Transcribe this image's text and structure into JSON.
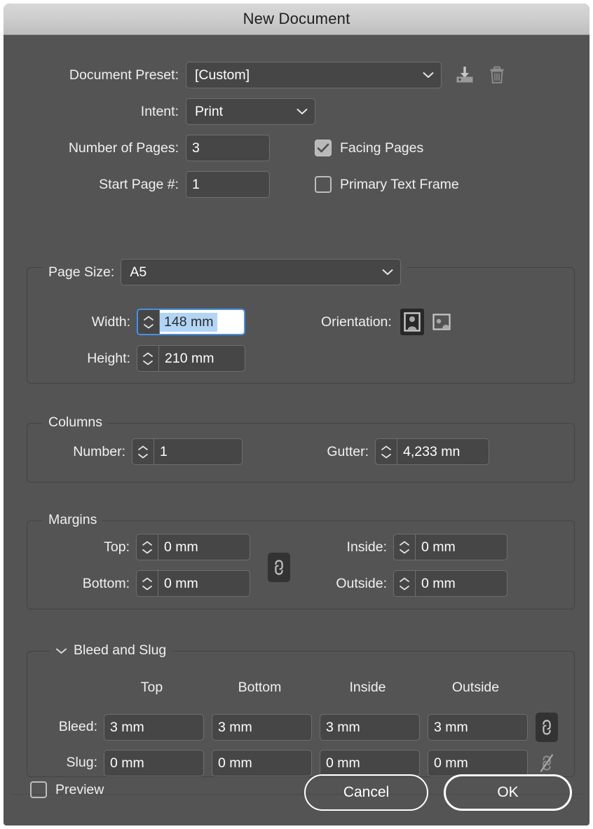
{
  "window": {
    "title": "New Document"
  },
  "preset": {
    "label": "Document Preset:",
    "value": "[Custom]",
    "save_icon": "save-preset-icon",
    "delete_icon": "trash-icon"
  },
  "intent": {
    "label": "Intent:",
    "value": "Print"
  },
  "pages": {
    "number_label": "Number of Pages:",
    "number_value": "3",
    "start_label": "Start Page #:",
    "start_value": "1",
    "facing_pages_label": "Facing Pages",
    "facing_pages_checked": true,
    "primary_text_frame_label": "Primary Text Frame",
    "primary_text_frame_checked": false
  },
  "page_size": {
    "group_label": "Page Size:",
    "value": "A5",
    "width_label": "Width:",
    "width_value": "148 mm",
    "height_label": "Height:",
    "height_value": "210 mm",
    "orientation_label": "Orientation:",
    "orientation_selected": "portrait"
  },
  "columns": {
    "group_label": "Columns",
    "number_label": "Number:",
    "number_value": "1",
    "gutter_label": "Gutter:",
    "gutter_value": "4,233 mn"
  },
  "margins": {
    "group_label": "Margins",
    "top_label": "Top:",
    "top_value": "0 mm",
    "bottom_label": "Bottom:",
    "bottom_value": "0 mm",
    "inside_label": "Inside:",
    "inside_value": "0 mm",
    "outside_label": "Outside:",
    "outside_value": "0 mm",
    "link_icon": "chain-link-icon",
    "link_enabled": true
  },
  "bleed_and_slug": {
    "group_label": "Bleed and Slug",
    "disclosure_icon": "chevron-down-icon",
    "expanded": true,
    "columns": [
      "Top",
      "Bottom",
      "Inside",
      "Outside"
    ],
    "rows": [
      {
        "label": "Bleed:",
        "values": [
          "3 mm",
          "3 mm",
          "3 mm",
          "3 mm"
        ],
        "link_icon": "chain-link-icon",
        "link_enabled": true
      },
      {
        "label": "Slug:",
        "values": [
          "0 mm",
          "0 mm",
          "0 mm",
          "0 mm"
        ],
        "link_icon": "broken-chain-link-icon",
        "link_enabled": false
      }
    ]
  },
  "footer": {
    "preview_label": "Preview",
    "preview_checked": false,
    "cancel_label": "Cancel",
    "ok_label": "OK"
  },
  "colors": {
    "dialog_bg": "#545454",
    "field_bg": "#464646",
    "field_border": "#6e6e6e",
    "titlebar_top": "#d8d8d8",
    "focus_border": "#4a90e2",
    "selection_bg": "#b3d5f5",
    "text": "#f0f0f0"
  }
}
